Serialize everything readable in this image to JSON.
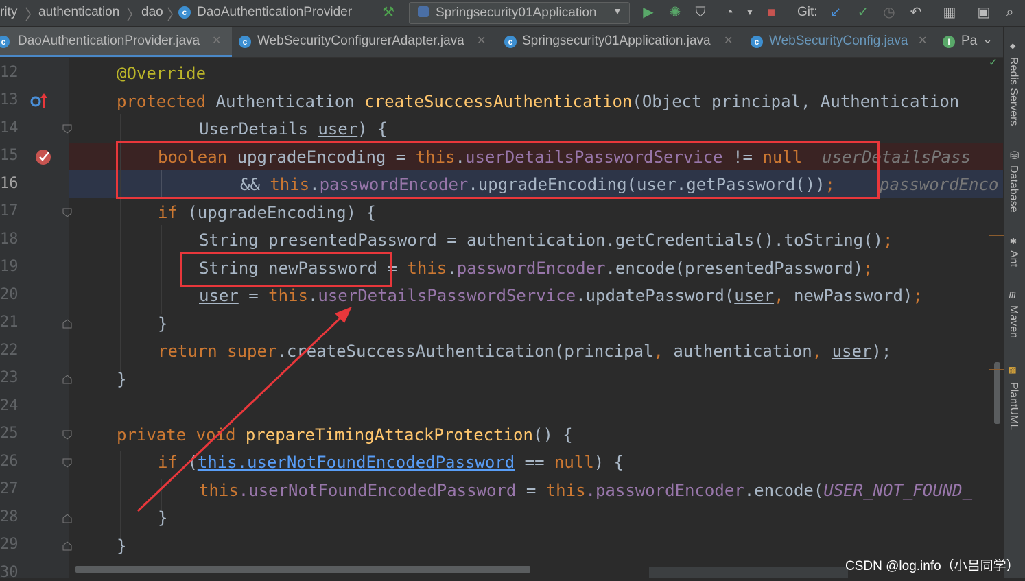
{
  "breadcrumbs": [
    "rity",
    "authentication",
    "dao",
    "DaoAuthenticationProvider"
  ],
  "run_config": "Springsecurity01Application",
  "git_label": "Git:",
  "tabs": [
    {
      "label": "DaoAuthenticationProvider.java",
      "active": true
    },
    {
      "label": "WebSecurityConfigurerAdapter.java",
      "active": false
    },
    {
      "label": "Springsecurity01Application.java",
      "active": false
    },
    {
      "label": "WebSecurityConfig.java",
      "active": false
    },
    {
      "label": "Pa",
      "active": false
    }
  ],
  "line_numbers": [
    "12",
    "13",
    "14",
    "15",
    "16",
    "17",
    "18",
    "19",
    "20",
    "21",
    "22",
    "23",
    "24",
    "25",
    "26",
    "27",
    "28",
    "29",
    "30"
  ],
  "code": {
    "l12_annotation": "@Override",
    "l13_kw": "protected",
    "l13_type": "Authentication",
    "l13_method": "createSuccessAuthentication",
    "l13_params": "(Object principal, Authentication",
    "l14_text": "UserDetails ",
    "l14_param": "user",
    "l14_end": ") {",
    "l15_kw": "boolean",
    "l15_var": " upgradeEncoding = ",
    "l15_this": "this",
    "l15_field": "userDetailsPasswordService",
    "l15_op": " != ",
    "l15_null": "null",
    "l15_hint": "userDetailsPass",
    "l16_op": "&& ",
    "l16_this": "this",
    "l16_field": "passwordEncoder",
    "l16_call": ".upgradeEncoding(user.getPassword())",
    "l16_semi": ";",
    "l16_hint": "passwordEnco",
    "l17_kw": "if",
    "l17_rest": " (upgradeEncoding) {",
    "l18_text": "String presentedPassword = authentication.getCredentials().toString()",
    "l18_semi": ";",
    "l19_decl": "String newPassword",
    "l19_eq": " = ",
    "l19_this": "this",
    "l19_field": "passwordEncoder",
    "l19_call": ".encode(presentedPassword)",
    "l19_semi": ";",
    "l20_user": "user",
    "l20_eq": " = ",
    "l20_this": "this",
    "l20_field": "userDetailsPasswordService",
    "l20_call": ".updatePassword(",
    "l20_arg": "user",
    "l20_comma": ", ",
    "l20_rest": "newPassword)",
    "l20_semi": ";",
    "l21_text": "}",
    "l22_kw": "return",
    "l22_super": " super",
    "l22_call": ".createSuccessAuthentication(principal",
    "l22_comma": ", ",
    "l22_mid": "authentication",
    "l22_comma2": ", ",
    "l22_user": "user",
    "l22_end": ");",
    "l23_text": "}",
    "l25_kw": "private",
    "l25_void": " void ",
    "l25_method": "prepareTimingAttackProtection",
    "l25_end": "() {",
    "l26_kw": "if",
    "l26_open": " (",
    "l26_link": "this.userNotFoundEncodedPassword",
    "l26_op": " == ",
    "l26_null": "null",
    "l26_end": ") {",
    "l27_this": "this",
    "l27_field": ".userNotFoundEncodedPassword",
    "l27_eq": " = ",
    "l27_this2": "this",
    "l27_field2": ".passwordEncoder",
    "l27_call": ".encode(",
    "l27_const": "USER_NOT_FOUND_",
    "l28_text": "}",
    "l29_text": "}"
  },
  "right_tools": [
    "Redis Servers",
    "Database",
    "Ant",
    "Maven",
    "PlantUML"
  ],
  "watermark": "CSDN @log.info（小吕同学）",
  "colors": {
    "keyword": "#cc7832",
    "field": "#9876aa",
    "method": "#ffc66d",
    "annotation": "#bbb529",
    "highlight_box": "#e8373b"
  }
}
